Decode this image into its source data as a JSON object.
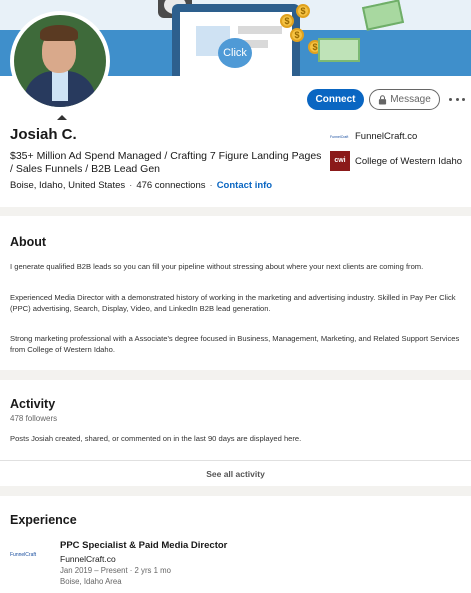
{
  "banner": {
    "click_label": "Click"
  },
  "profile": {
    "name": "Josiah C.",
    "headline": "$35+ Million Ad Spend Managed / Crafting 7 Figure Landing Pages / Sales Funnels / B2B Lead Gen",
    "location": "Boise, Idaho, United States",
    "connections": "476 connections",
    "contact_info": "Contact info",
    "actions": {
      "connect": "Connect",
      "message": "Message"
    },
    "orgs": [
      {
        "name": "FunnelCraft.co",
        "icon": "funnelcraft-logo",
        "logo_text": "FunnelCraft"
      },
      {
        "name": "College of Western Idaho",
        "icon": "cwi-logo",
        "logo_text": "cwi"
      }
    ]
  },
  "about": {
    "title": "About",
    "paragraphs": [
      "I generate qualified B2B leads so you can fill your pipeline without stressing about where your next clients are coming from.",
      "Experienced Media Director with a demonstrated history of working in the marketing and advertising industry. Skilled in Pay Per Click (PPC) advertising, Search, Display, Video, and LinkedIn B2B lead generation.",
      "Strong marketing professional with a Associate's degree focused in Business, Management, Marketing, and Related Support Services from College of Western Idaho."
    ]
  },
  "activity": {
    "title": "Activity",
    "followers": "478 followers",
    "note": "Posts Josiah created, shared, or commented on in the last 90 days are displayed here.",
    "see_all": "See all activity"
  },
  "experience": {
    "title": "Experience",
    "items": [
      {
        "logo_text": "FunnelCraft",
        "title": "PPC Specialist & Paid Media Director",
        "company": "FunnelCraft.co",
        "dates": "Jan 2019 – Present · 2 yrs 1 mo",
        "location": "Boise, Idaho Area"
      }
    ]
  },
  "colors": {
    "accent": "#0a66c2",
    "background": "#f3f2ef"
  }
}
